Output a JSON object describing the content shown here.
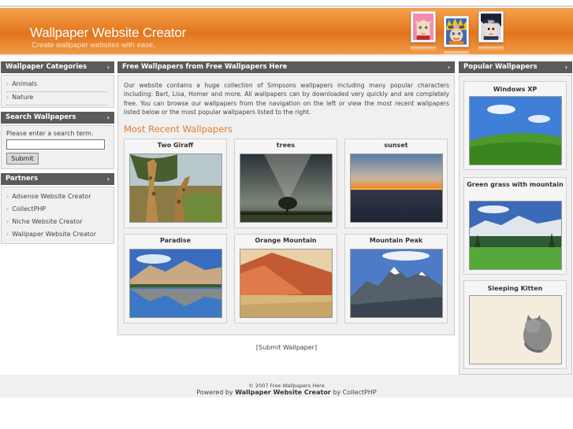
{
  "header": {
    "title": "Wallpaper Website Creator",
    "tagline": "Create wallpaper websites with ease."
  },
  "avatars": [
    "sakura-avatar",
    "naruto-avatar",
    "sasuke-avatar"
  ],
  "colors": {
    "header_orange": "#e2751e",
    "panel_heading": "#5b5b5b",
    "accent_title": "#e47b2a"
  },
  "sidebar": {
    "categories_heading": "Wallpaper Categories",
    "categories": [
      "Animals",
      "Nature"
    ],
    "search_heading": "Search Wallpapers",
    "search_label": "Please enter a search term.",
    "search_value": "",
    "search_button": "Submit",
    "partners_heading": "Partners",
    "partners": [
      "Adsense Website Creator",
      "CollectPHP",
      "Niche Website Creator",
      "Wallpaper Website Creator"
    ]
  },
  "main": {
    "heading": "Free Wallpapers from Free Wallpapers Here",
    "intro": "Our website contains a huge collection of Simpsons wallpapers including many popular characters including: Bart, Lisa, Homer and more. All wallpapers can by downloaded very quickly and are completely free. You can browse our wallpapers from the navigation on the left or view the most recent wallpapers listed below or the most popular wallpapers listed to the right.",
    "recent_title": "Most Recent Wallpapers",
    "wallpapers": [
      "Two Giraff",
      "trees",
      "sunset",
      "Paradise",
      "Orange Mountain",
      "Mountain Peak"
    ]
  },
  "popular": {
    "heading": "Popular Wallpapers",
    "items": [
      "Windows XP",
      "Green grass with mountain",
      "Sleeping Kitten"
    ]
  },
  "submit_link": "[Submit Wallpaper]",
  "footer": {
    "copyright": "© 2007 Free Wallpapers Here",
    "powered_prefix": "Powered by",
    "powered_name": "Wallpaper Website Creator",
    "powered_suffix": "by CollectPHP"
  }
}
